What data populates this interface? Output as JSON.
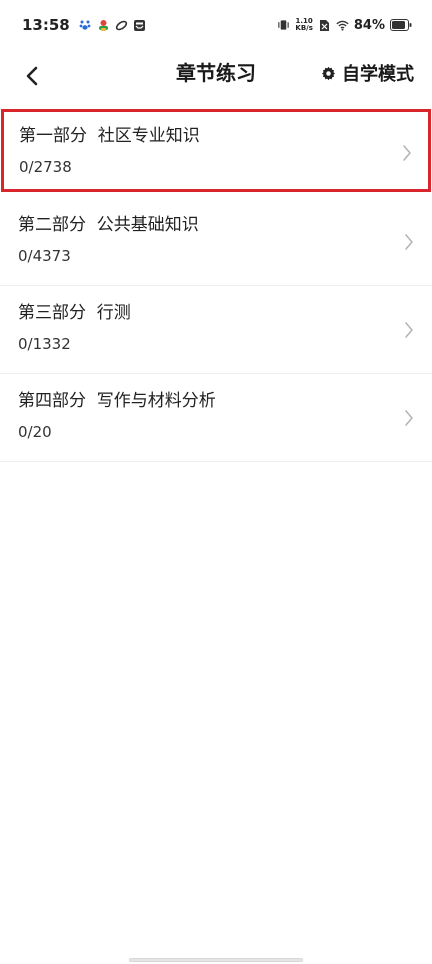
{
  "status_bar": {
    "time": "13:58",
    "net_speed_value": "1.10",
    "net_speed_unit": "KB/s",
    "battery_percent": "84%"
  },
  "header": {
    "title": "章节练习",
    "mode_label": "自学模式"
  },
  "chapters": [
    {
      "title": "第一部分  社区专业知识",
      "progress": "0/2738"
    },
    {
      "title": "第二部分  公共基础知识",
      "progress": "0/4373"
    },
    {
      "title": "第三部分  行测",
      "progress": "0/1332"
    },
    {
      "title": "第四部分  写作与材料分析",
      "progress": "0/20"
    }
  ],
  "colors": {
    "highlight_border": "#d9262c",
    "divider": "#eeeeee",
    "chevron": "#b5b5b5"
  }
}
